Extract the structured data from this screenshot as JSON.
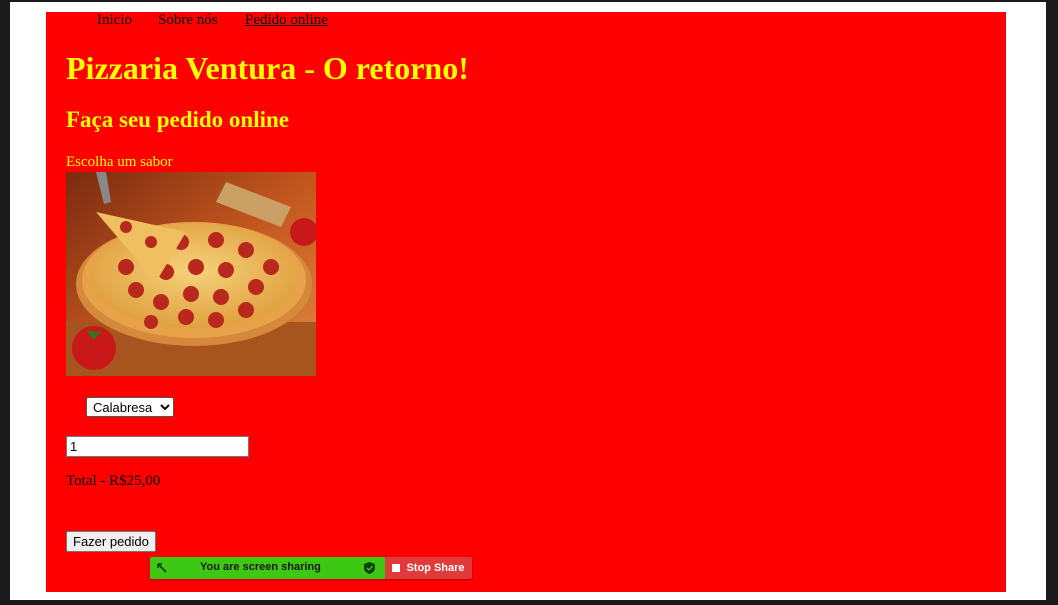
{
  "nav": {
    "items": [
      {
        "label": "Inicio",
        "active": false
      },
      {
        "label": "Sobre nós",
        "active": false
      },
      {
        "label": "Pedido online",
        "active": true
      }
    ]
  },
  "header": {
    "title": "Pizzaria Ventura - O retorno!",
    "subtitle": "Faça seu pedido online"
  },
  "order": {
    "choose_label": "Escolha um sabor",
    "image_icon": "pepperoni-pizza-photo",
    "flavor_selected": "Calabresa",
    "quantity_value": "1",
    "total_text": "Total - R$25,00",
    "submit_label": "Fazer pedido"
  },
  "screen_share": {
    "status_text": "You are screen sharing",
    "stop_label": "Stop Share",
    "status_color": "#3cc813",
    "stop_color": "#e03a3a"
  },
  "colors": {
    "panel_bg": "#ff0000",
    "heading": "#ffff00"
  }
}
